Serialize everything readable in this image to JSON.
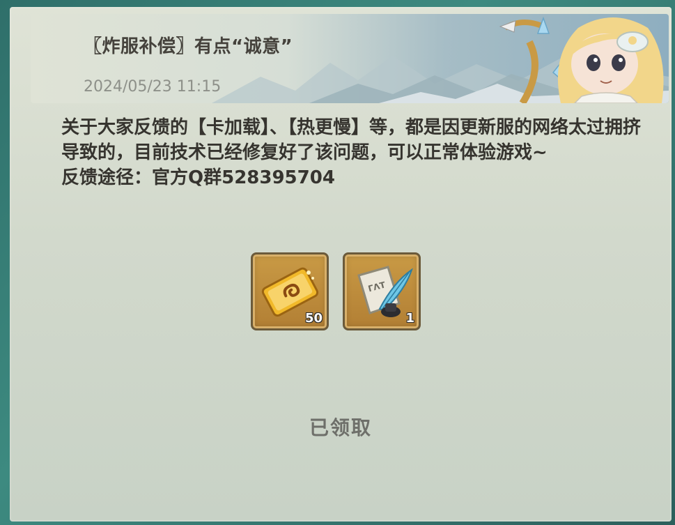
{
  "mail": {
    "title": "〖炸服补偿〗有点“诚意”",
    "date": "2024/05/23 11:15",
    "body_line1": "关于大家反馈的【卡加载】、【热更慢】等，都是因更新服的网络太过拥挤导致的，目前技术已经修复好了该问题，可以正常体验游戏~",
    "body_line2": "反馈途径：官方Q群528395704"
  },
  "rewards": [
    {
      "icon": "gold-ticket-icon",
      "count": "50"
    },
    {
      "icon": "scroll-quill-icon",
      "count": "1"
    }
  ],
  "status": {
    "claimed_label": "已领取"
  },
  "colors": {
    "title": "#45423c",
    "date": "#8d9089",
    "body": "#36342f",
    "slot_gold": "#c99a45",
    "claimed": "#6e6f6a"
  }
}
